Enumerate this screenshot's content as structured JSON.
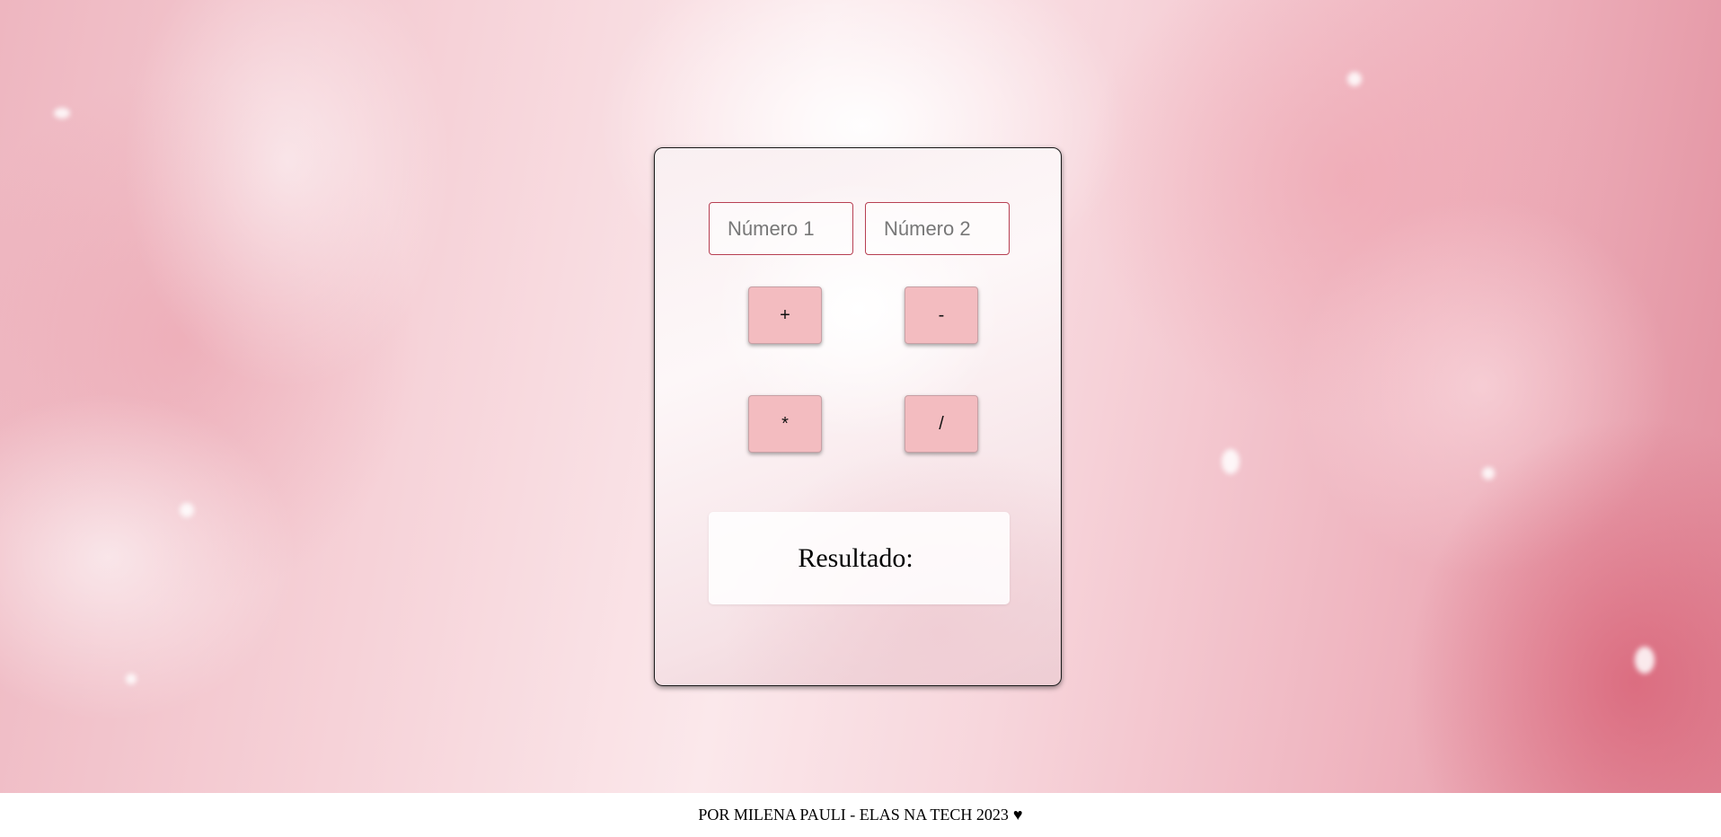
{
  "calculator": {
    "input1": {
      "placeholder": "Número 1",
      "value": ""
    },
    "input2": {
      "placeholder": "Número 2",
      "value": ""
    },
    "buttons": {
      "add": "+",
      "subtract": "-",
      "multiply": "*",
      "divide": "/"
    },
    "result": {
      "label": "Resultado:",
      "value": ""
    }
  },
  "footer": {
    "text": "POR MILENA PAULI - ELAS NA TECH 2023",
    "heart": "♥"
  },
  "colors": {
    "button_bg": "#f3bcc0",
    "input_border": "#b73f52",
    "panel_border": "#1a1a1a"
  },
  "icons": {
    "heart": "heart-icon"
  }
}
